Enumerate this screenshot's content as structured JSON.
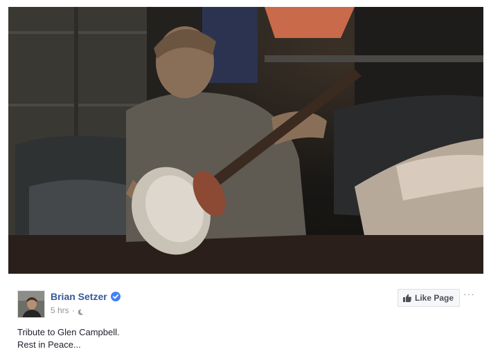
{
  "video": {
    "description_icon": "video-frame"
  },
  "post": {
    "author": "Brian Setzer",
    "verified_icon": "verified-badge-icon",
    "timestamp": "5 hrs",
    "separator": "·",
    "audience_icon": "moon-icon",
    "like_page_label": "Like Page",
    "more_label": "···",
    "text_line1": "Tribute to Glen Campbell.",
    "text_line2": "Rest in Peace...",
    "colors": {
      "author": "#365899",
      "meta": "#90949c",
      "verified": "#4080ff"
    }
  }
}
